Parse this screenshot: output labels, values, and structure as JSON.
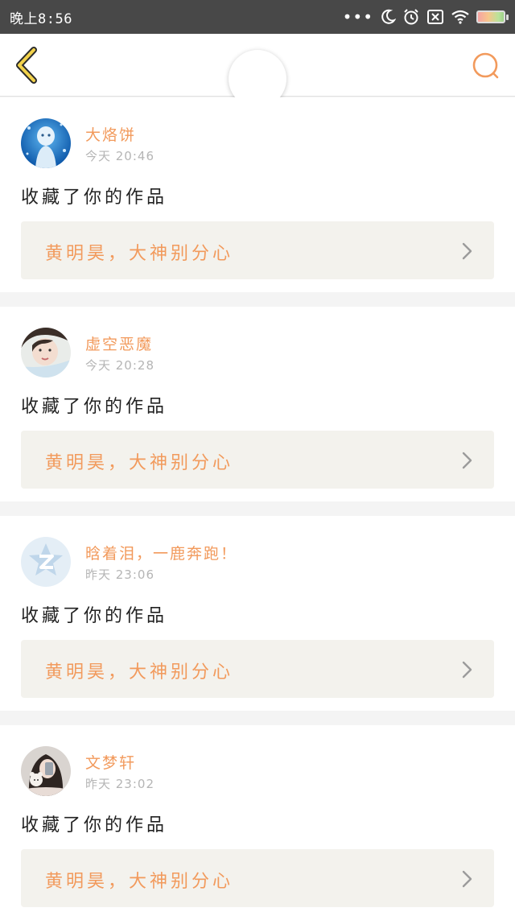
{
  "status_bar": {
    "time": "晚上8:56",
    "icons": [
      "more-dots-icon",
      "moon-icon",
      "alarm-icon",
      "no-sim-icon",
      "wifi-icon",
      "battery-icon"
    ],
    "dots": "•••"
  },
  "header": {
    "title": "",
    "back_icon": "back-chevron-icon",
    "search_icon": "search-icon",
    "colors": {
      "accent": "#f29a5c",
      "back_stroke": "#2b2b2b",
      "back_fill": "#f2d24b"
    }
  },
  "feed": [
    {
      "avatar": "avatar-blue-doll",
      "username": "大烙饼",
      "time": "今天 20:46",
      "action": "收藏了你的作品",
      "work_title": "黄明昊，大神别分心"
    },
    {
      "avatar": "avatar-girl-photo",
      "username": "虚空恶魔",
      "time": "今天 20:28",
      "action": "收藏了你的作品",
      "work_title": "黄明昊，大神别分心"
    },
    {
      "avatar": "avatar-default-qq",
      "username": "晗着泪，一鹿奔跑！",
      "time": "昨天 23:06",
      "action": "收藏了你的作品",
      "work_title": "黄明昊，大神别分心"
    },
    {
      "avatar": "avatar-selfie",
      "username": "文梦轩",
      "time": "昨天 23:02",
      "action": "收藏了你的作品",
      "work_title": "黄明昊，大神别分心"
    }
  ]
}
